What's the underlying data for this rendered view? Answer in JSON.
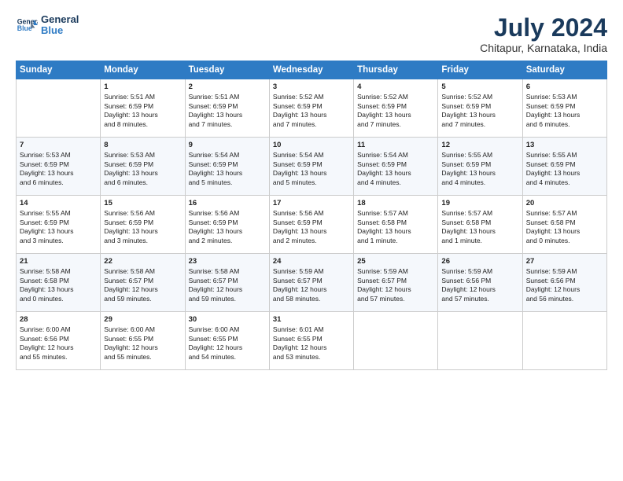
{
  "header": {
    "logo_line1": "General",
    "logo_line2": "Blue",
    "month": "July 2024",
    "location": "Chitapur, Karnataka, India"
  },
  "days_of_week": [
    "Sunday",
    "Monday",
    "Tuesday",
    "Wednesday",
    "Thursday",
    "Friday",
    "Saturday"
  ],
  "weeks": [
    [
      {
        "day": "",
        "info": ""
      },
      {
        "day": "1",
        "info": "Sunrise: 5:51 AM\nSunset: 6:59 PM\nDaylight: 13 hours\nand 8 minutes."
      },
      {
        "day": "2",
        "info": "Sunrise: 5:51 AM\nSunset: 6:59 PM\nDaylight: 13 hours\nand 7 minutes."
      },
      {
        "day": "3",
        "info": "Sunrise: 5:52 AM\nSunset: 6:59 PM\nDaylight: 13 hours\nand 7 minutes."
      },
      {
        "day": "4",
        "info": "Sunrise: 5:52 AM\nSunset: 6:59 PM\nDaylight: 13 hours\nand 7 minutes."
      },
      {
        "day": "5",
        "info": "Sunrise: 5:52 AM\nSunset: 6:59 PM\nDaylight: 13 hours\nand 7 minutes."
      },
      {
        "day": "6",
        "info": "Sunrise: 5:53 AM\nSunset: 6:59 PM\nDaylight: 13 hours\nand 6 minutes."
      }
    ],
    [
      {
        "day": "7",
        "info": "Sunrise: 5:53 AM\nSunset: 6:59 PM\nDaylight: 13 hours\nand 6 minutes."
      },
      {
        "day": "8",
        "info": "Sunrise: 5:53 AM\nSunset: 6:59 PM\nDaylight: 13 hours\nand 6 minutes."
      },
      {
        "day": "9",
        "info": "Sunrise: 5:54 AM\nSunset: 6:59 PM\nDaylight: 13 hours\nand 5 minutes."
      },
      {
        "day": "10",
        "info": "Sunrise: 5:54 AM\nSunset: 6:59 PM\nDaylight: 13 hours\nand 5 minutes."
      },
      {
        "day": "11",
        "info": "Sunrise: 5:54 AM\nSunset: 6:59 PM\nDaylight: 13 hours\nand 4 minutes."
      },
      {
        "day": "12",
        "info": "Sunrise: 5:55 AM\nSunset: 6:59 PM\nDaylight: 13 hours\nand 4 minutes."
      },
      {
        "day": "13",
        "info": "Sunrise: 5:55 AM\nSunset: 6:59 PM\nDaylight: 13 hours\nand 4 minutes."
      }
    ],
    [
      {
        "day": "14",
        "info": "Sunrise: 5:55 AM\nSunset: 6:59 PM\nDaylight: 13 hours\nand 3 minutes."
      },
      {
        "day": "15",
        "info": "Sunrise: 5:56 AM\nSunset: 6:59 PM\nDaylight: 13 hours\nand 3 minutes."
      },
      {
        "day": "16",
        "info": "Sunrise: 5:56 AM\nSunset: 6:59 PM\nDaylight: 13 hours\nand 2 minutes."
      },
      {
        "day": "17",
        "info": "Sunrise: 5:56 AM\nSunset: 6:59 PM\nDaylight: 13 hours\nand 2 minutes."
      },
      {
        "day": "18",
        "info": "Sunrise: 5:57 AM\nSunset: 6:58 PM\nDaylight: 13 hours\nand 1 minute."
      },
      {
        "day": "19",
        "info": "Sunrise: 5:57 AM\nSunset: 6:58 PM\nDaylight: 13 hours\nand 1 minute."
      },
      {
        "day": "20",
        "info": "Sunrise: 5:57 AM\nSunset: 6:58 PM\nDaylight: 13 hours\nand 0 minutes."
      }
    ],
    [
      {
        "day": "21",
        "info": "Sunrise: 5:58 AM\nSunset: 6:58 PM\nDaylight: 13 hours\nand 0 minutes."
      },
      {
        "day": "22",
        "info": "Sunrise: 5:58 AM\nSunset: 6:57 PM\nDaylight: 12 hours\nand 59 minutes."
      },
      {
        "day": "23",
        "info": "Sunrise: 5:58 AM\nSunset: 6:57 PM\nDaylight: 12 hours\nand 59 minutes."
      },
      {
        "day": "24",
        "info": "Sunrise: 5:59 AM\nSunset: 6:57 PM\nDaylight: 12 hours\nand 58 minutes."
      },
      {
        "day": "25",
        "info": "Sunrise: 5:59 AM\nSunset: 6:57 PM\nDaylight: 12 hours\nand 57 minutes."
      },
      {
        "day": "26",
        "info": "Sunrise: 5:59 AM\nSunset: 6:56 PM\nDaylight: 12 hours\nand 57 minutes."
      },
      {
        "day": "27",
        "info": "Sunrise: 5:59 AM\nSunset: 6:56 PM\nDaylight: 12 hours\nand 56 minutes."
      }
    ],
    [
      {
        "day": "28",
        "info": "Sunrise: 6:00 AM\nSunset: 6:56 PM\nDaylight: 12 hours\nand 55 minutes."
      },
      {
        "day": "29",
        "info": "Sunrise: 6:00 AM\nSunset: 6:55 PM\nDaylight: 12 hours\nand 55 minutes."
      },
      {
        "day": "30",
        "info": "Sunrise: 6:00 AM\nSunset: 6:55 PM\nDaylight: 12 hours\nand 54 minutes."
      },
      {
        "day": "31",
        "info": "Sunrise: 6:01 AM\nSunset: 6:55 PM\nDaylight: 12 hours\nand 53 minutes."
      },
      {
        "day": "",
        "info": ""
      },
      {
        "day": "",
        "info": ""
      },
      {
        "day": "",
        "info": ""
      }
    ]
  ]
}
